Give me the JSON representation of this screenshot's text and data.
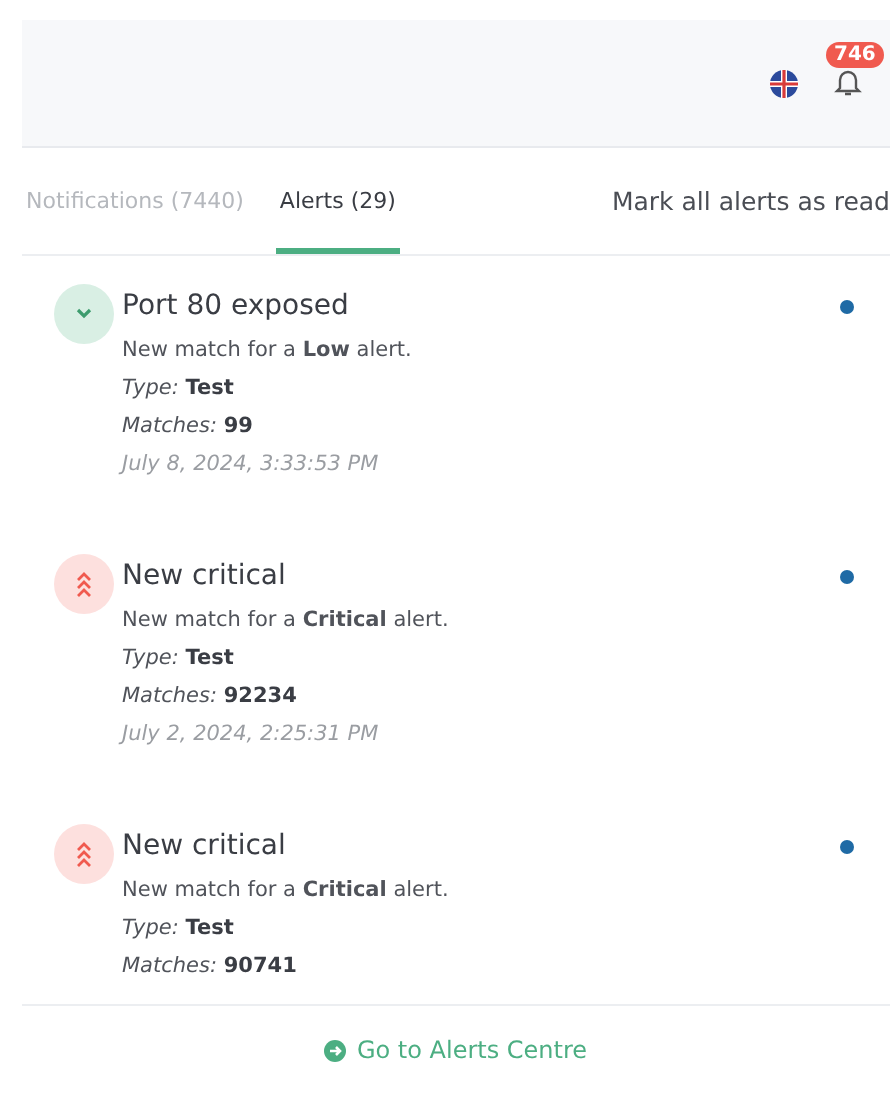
{
  "header": {
    "badge": "746"
  },
  "tabs": [
    {
      "label": "Notifications (7440)",
      "selected": false
    },
    {
      "label": "Alerts (29)",
      "selected": true
    }
  ],
  "mark_all": "Mark all alerts as read",
  "alerts": [
    {
      "kind": "low",
      "title": "Port 80 exposed",
      "description": "New match for a **Low** alert.",
      "type_label": "Type:",
      "type": "Test",
      "matches_label": "Matches:",
      "matches": "99",
      "date": "July 8, 2024, 3:33:53 PM",
      "unread": true
    },
    {
      "kind": "critical",
      "title": "New critical",
      "description": "New match for a **Critical** alert.",
      "type_label": "Type:",
      "type": "Test",
      "matches_label": "Matches:",
      "matches": "92234",
      "date": "July 2, 2024, 2:25:31 PM",
      "unread": true
    },
    {
      "kind": "critical",
      "title": "New critical",
      "description": "New match for a **Critical** alert.",
      "type_label": "Type:",
      "type": "Test",
      "matches_label": "Matches:",
      "matches": "90741",
      "unread": true
    }
  ],
  "footer": {
    "link": "Go to Alerts Centre"
  }
}
